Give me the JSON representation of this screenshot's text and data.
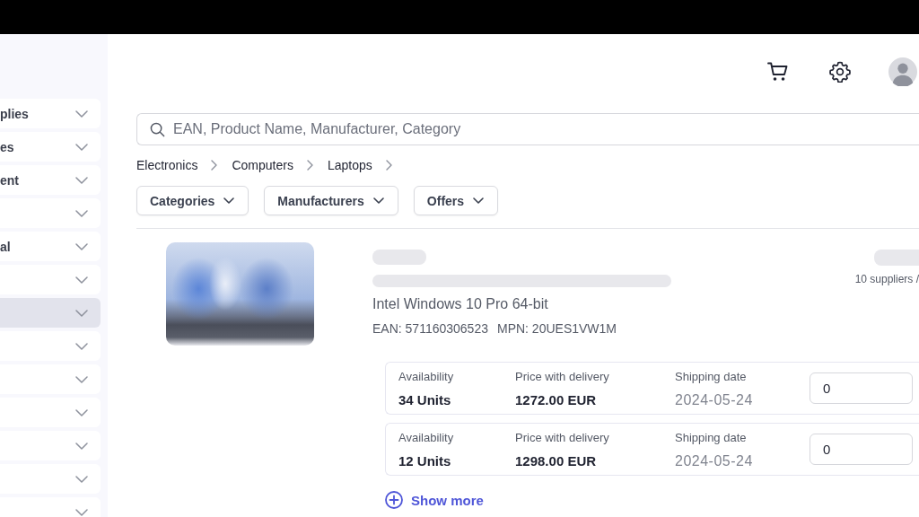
{
  "sidebar": {
    "items": [
      {
        "label": "plies",
        "selected": false
      },
      {
        "label": "es",
        "selected": false
      },
      {
        "label": "ent",
        "selected": false
      },
      {
        "selected": false
      },
      {
        "label": "al",
        "selected": false
      },
      {
        "selected": false
      },
      {
        "selected": true
      },
      {
        "selected": false
      },
      {
        "selected": false
      },
      {
        "selected": false
      },
      {
        "selected": false
      },
      {
        "selected": false
      },
      {
        "selected": false
      }
    ]
  },
  "search": {
    "placeholder": "EAN, Product Name, Manufacturer, Category"
  },
  "breadcrumbs": [
    "Electronics",
    "Computers",
    "Laptops"
  ],
  "filters": [
    "Categories",
    "Manufacturers",
    "Offers"
  ],
  "product": {
    "description": "Intel Windows 10 Pro 64-bit",
    "ean": "EAN: 571160306523",
    "mpn": "MPN: 20UES1VW1M",
    "suppliers": "10 suppliers /"
  },
  "offers": [
    {
      "availability_label": "Availability",
      "availability": "34 Units",
      "price_label": "Price with delivery",
      "price": "1272.00 EUR",
      "shipping_label": "Shipping date",
      "shipping_date": "2024-05-24",
      "quantity": "0"
    },
    {
      "availability_label": "Availability",
      "availability": "12 Units",
      "price_label": "Price with delivery",
      "price": "1298.00 EUR",
      "shipping_label": "Shipping date",
      "shipping_date": "2024-05-24",
      "quantity": "0"
    }
  ],
  "show_more": "Show more"
}
